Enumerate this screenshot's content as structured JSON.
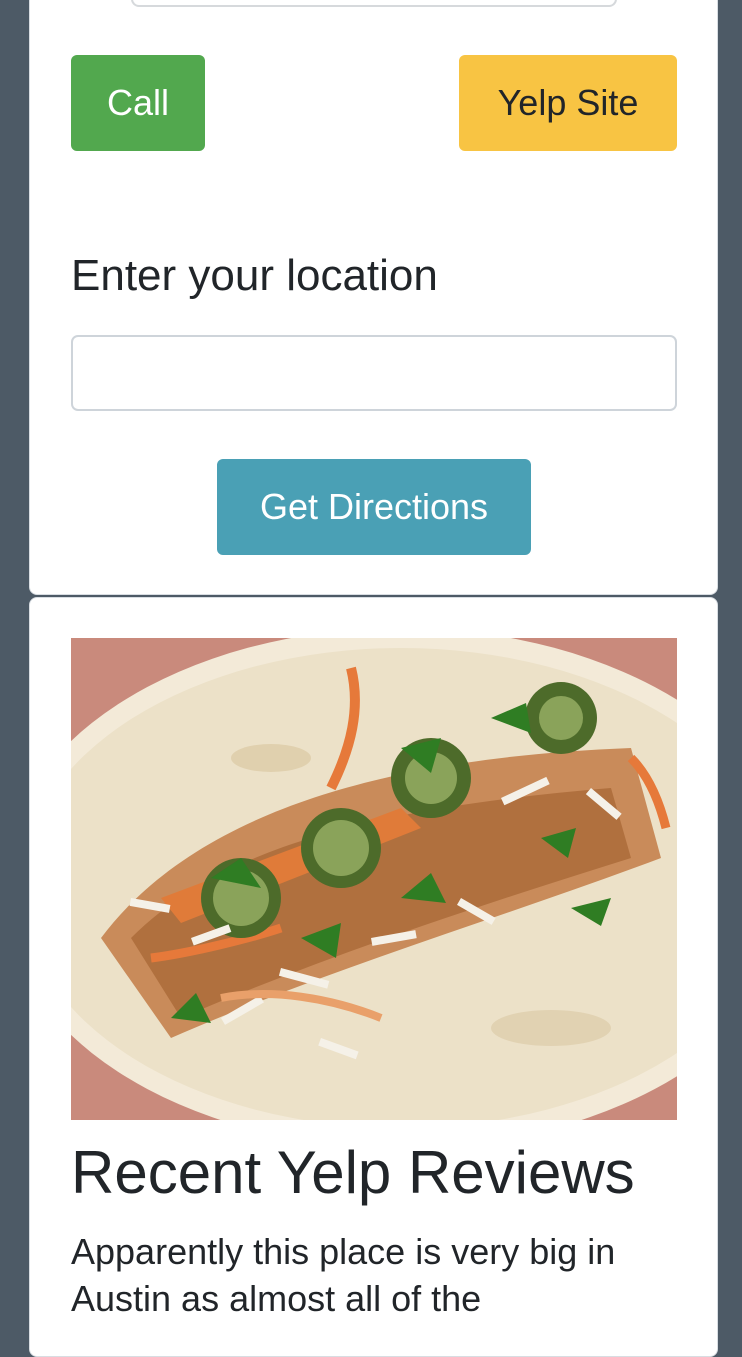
{
  "actions": {
    "call_label": "Call",
    "yelp_label": "Yelp Site"
  },
  "directions": {
    "label": "Enter your location",
    "input_value": "",
    "input_placeholder": "",
    "button_label": "Get Directions"
  },
  "reviews": {
    "title": "Recent Yelp Reviews",
    "first_review": "Apparently this place is very big in Austin as almost all of the"
  },
  "colors": {
    "background": "#4d5a66",
    "call": "#52a84e",
    "yelp": "#f8c443",
    "directions": "#4aa0b5"
  },
  "image": {
    "subject": "taco photo"
  }
}
